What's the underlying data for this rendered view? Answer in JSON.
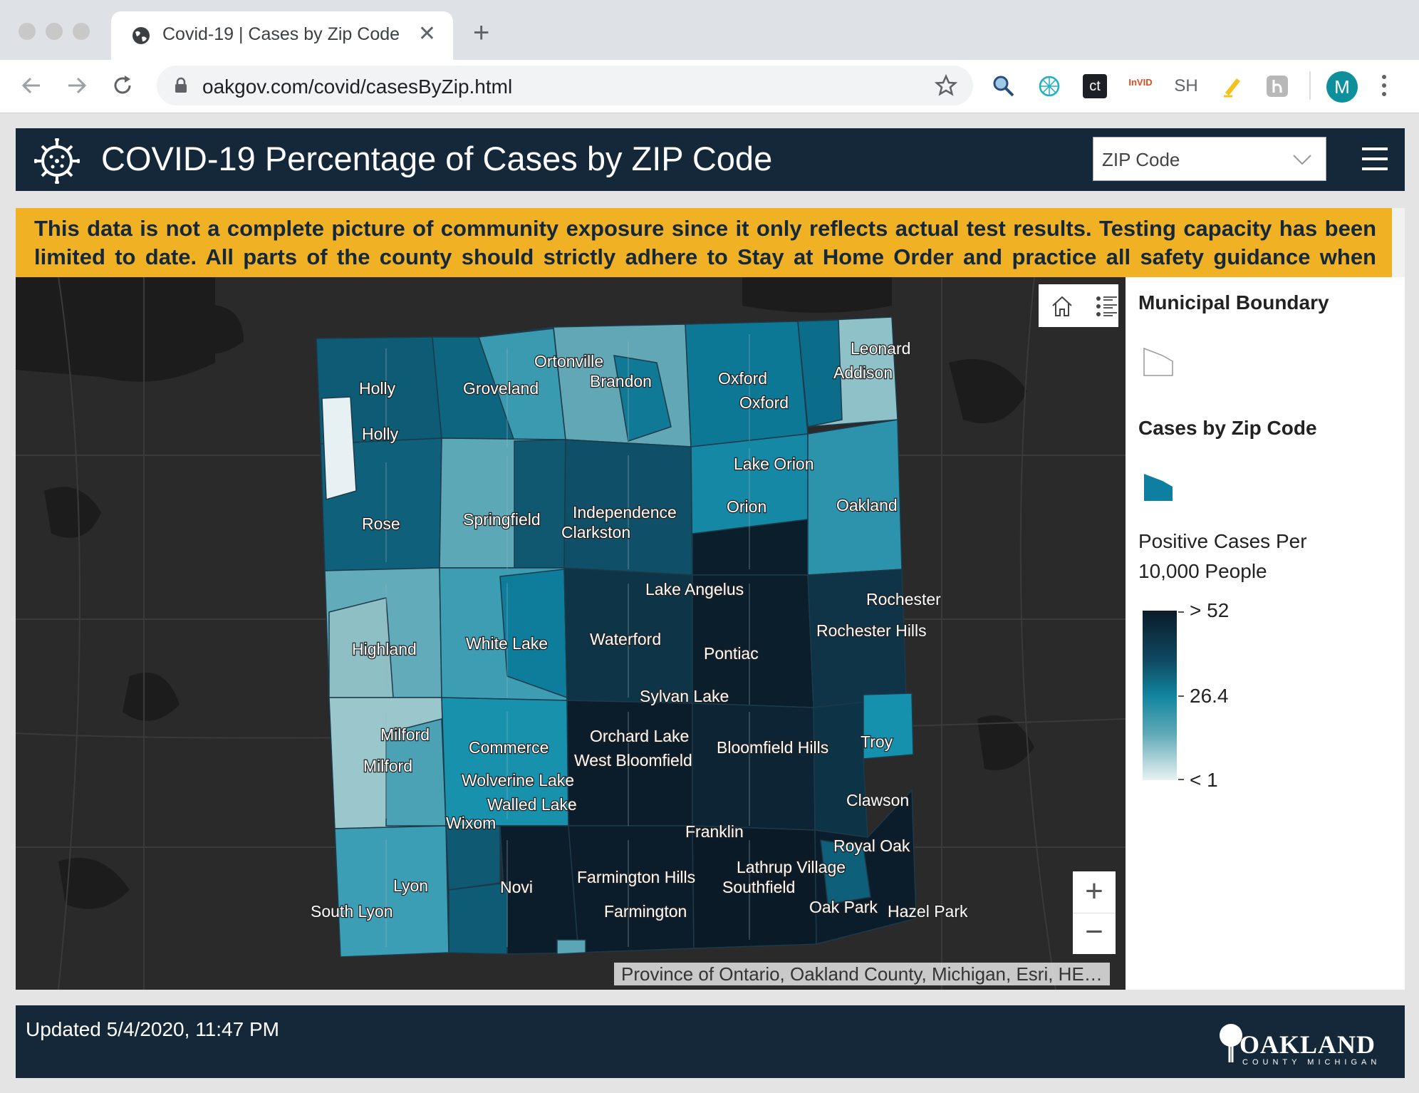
{
  "browser": {
    "tab_title": "Covid-19 | Cases by Zip Code",
    "url": "oakgov.com/covid/casesByZip.html",
    "extensions": [
      "magnifier-icon",
      "globe-mesh-icon",
      "ct-icon",
      "invid-icon",
      "SH",
      "highlighter-icon",
      "h-icon"
    ],
    "ext_ct": "ct",
    "ext_invid": "InVID",
    "ext_sh": "SH",
    "profile_initial": "M"
  },
  "app": {
    "title": "COVID-19 Percentage of Cases by ZIP Code",
    "search_select": "ZIP Code",
    "banner": "This data is not a complete picture of community exposure since it only reflects actual test results. Testing capacity has been limited to date. All parts of the county should strictly adhere to Stay at Home Order and practice all safety guidance when"
  },
  "map": {
    "attribution": "Province of Ontario, Oakland County, Michigan, Esri, HE…",
    "zoom_in": "+",
    "zoom_out": "−",
    "places": [
      "Leonard",
      "Ortonville",
      "Holly",
      "Groveland",
      "Brandon",
      "Oxford",
      "Addison",
      "Oxford",
      "Holly",
      "Lake Orion",
      "Rose",
      "Springfield",
      "Independence",
      "Clarkston",
      "Orion",
      "Oakland",
      "Lake Angelus",
      "Rochester",
      "Highland",
      "White Lake",
      "Waterford",
      "Pontiac",
      "Rochester Hills",
      "Sylvan Lake",
      "Milford",
      "Orchard Lake",
      "Commerce",
      "Troy",
      "Bloomfield Hills",
      "Milford",
      "West Bloomfield",
      "Wolverine Lake",
      "Walled Lake",
      "Clawson",
      "Wixom",
      "Franklin",
      "Royal Oak",
      "Lathrup Village",
      "Lyon",
      "Novi",
      "Farmington Hills",
      "Southfield",
      "Oak Park",
      "Hazel Park",
      "South Lyon",
      "Farmington"
    ]
  },
  "legend": {
    "municipal_title": "Municipal Boundary",
    "cases_title": "Cases by Zip Code",
    "field_label": "Positive Cases Per 10,000 People",
    "ramp_max": "> 52",
    "ramp_mid": "26.4",
    "ramp_min": "< 1",
    "colors": {
      "high": "#0b1b28",
      "mid": "#11849e",
      "low": "#e9f2f3"
    }
  },
  "footer": {
    "updated": "Updated 5/4/2020, 11:47 PM",
    "logo_text": "OAKLAND",
    "logo_sub": "COUNTY MICHIGAN"
  }
}
